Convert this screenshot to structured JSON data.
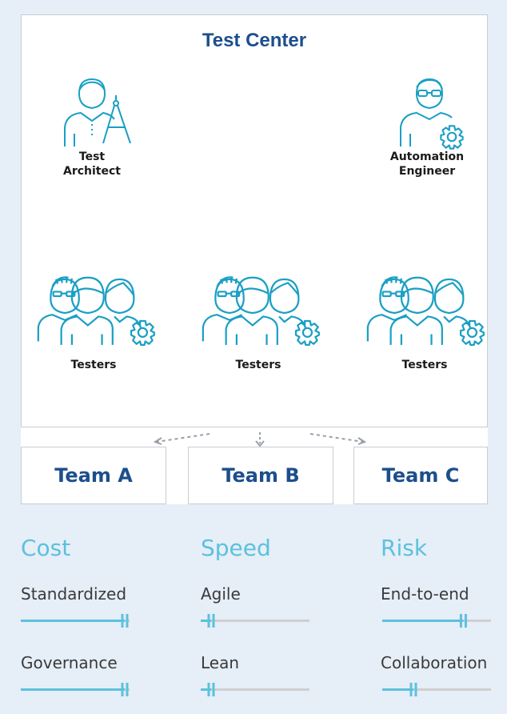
{
  "center": {
    "title": "Test Center"
  },
  "roles": {
    "architect": [
      "Test",
      "Architect"
    ],
    "automation": [
      "Automation",
      "Engineer"
    ],
    "testers": [
      "Testers",
      "Testers",
      "Testers"
    ]
  },
  "teams": [
    "Team A",
    "Team B",
    "Team C"
  ],
  "columns": [
    {
      "title": "Cost",
      "metrics": [
        {
          "label": "Standardized",
          "level": 1.0
        },
        {
          "label": "Governance",
          "level": 1.0
        }
      ]
    },
    {
      "title": "Speed",
      "metrics": [
        {
          "label": "Agile",
          "level": 0.1
        },
        {
          "label": "Lean",
          "level": 0.1
        }
      ]
    },
    {
      "title": "Risk",
      "metrics": [
        {
          "label": "End-to-end",
          "level": 0.78
        },
        {
          "label": "Collaboration",
          "level": 0.3
        }
      ]
    }
  ],
  "colors": {
    "navy": "#1d4e8c",
    "teal": "#1a9fc4",
    "accent": "#5bc1de",
    "track": "#cfcfcf",
    "background": "#e6eef7"
  }
}
